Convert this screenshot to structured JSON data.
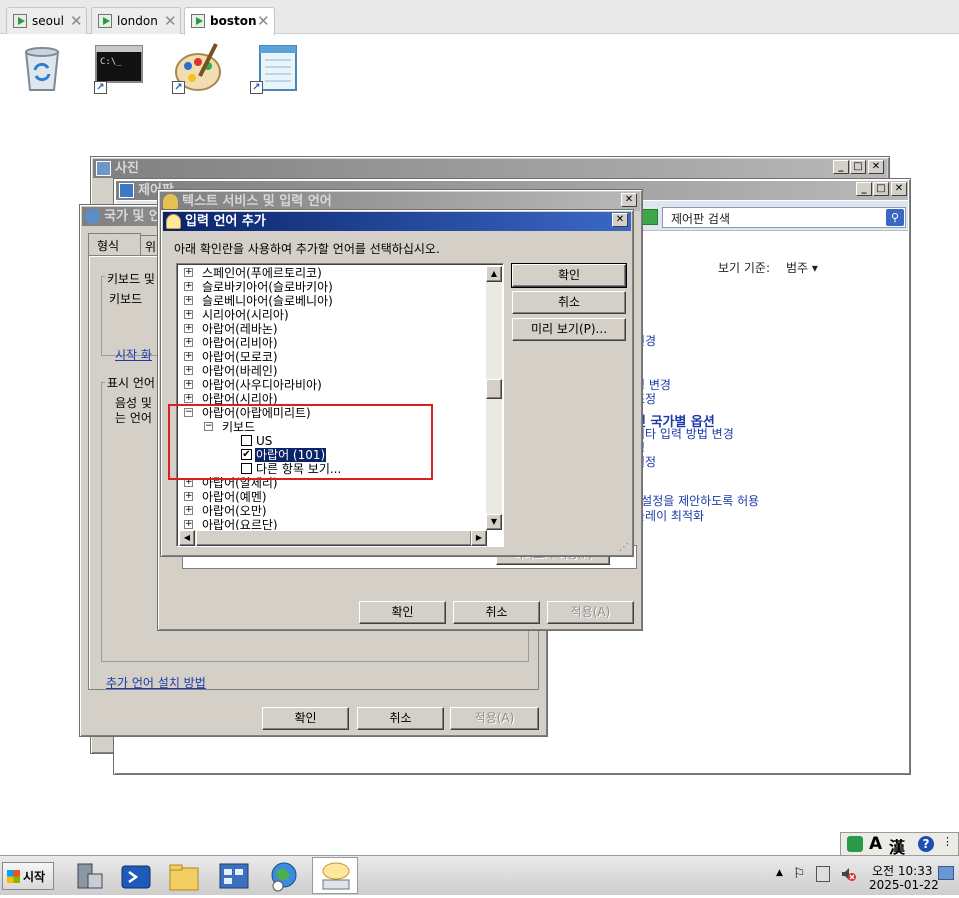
{
  "browser_tabs": [
    {
      "label": "seoul"
    },
    {
      "label": "london"
    },
    {
      "label": "boston"
    }
  ],
  "desktop": {
    "icons": [
      {
        "name": "recycle-bin"
      },
      {
        "name": "command-prompt"
      },
      {
        "name": "paint"
      },
      {
        "name": "notepad"
      }
    ]
  },
  "photos_window": {
    "title": "사진"
  },
  "control_panel": {
    "title": "제어판",
    "search_placeholder": "제어판 검색",
    "view_by_label": "보기 기준:",
    "view_by_value": "범주",
    "items": [
      {
        "text": "변경"
      },
      {
        "text": "경 변경"
      },
      {
        "text": "조정"
      },
      {
        "text": "및 국가별 옵션"
      },
      {
        "text": "기타 입력 방법 변경"
      },
      {
        "text": "경"
      },
      {
        "text": "설정"
      },
      {
        "text": "l 설정을 제안하도록 허용"
      },
      {
        "text": "들레이 최적화"
      }
    ]
  },
  "region_dialog": {
    "title": "국가 및 언어",
    "tabs": [
      "형식",
      "위"
    ],
    "keyboard_group": "키보드 및",
    "keyboard_text": "키보드 ",
    "start_link": "시작 화",
    "display_group": "표시 언어",
    "display_text_1": "음성 및",
    "display_text_2": "는 언어",
    "install_link": "추가 언어 설치 방법",
    "ok": "확인",
    "cancel": "취소",
    "apply": "적용(A)"
  },
  "text_services_dialog": {
    "title": "텍스트 서비스 및 입력 언어",
    "add_button_hint": "미리보기 허용(F)",
    "ok": "확인",
    "cancel": "취소",
    "apply": "적용(A)"
  },
  "add_language_dialog": {
    "title": "입력 언어 추가",
    "instruction": "아래 확인란을 사용하여 추가할 언어를 선택하십시오.",
    "ok": "확인",
    "cancel": "취소",
    "preview": "미리 보기(P)...",
    "tree": [
      {
        "label": "스페인어(푸에르토리코)",
        "level": 0,
        "expander": "+"
      },
      {
        "label": "슬로바키아어(슬로바키아)",
        "level": 0,
        "expander": "+"
      },
      {
        "label": "슬로베니아어(슬로베니아)",
        "level": 0,
        "expander": "+"
      },
      {
        "label": "시리아어(시리아)",
        "level": 0,
        "expander": "+"
      },
      {
        "label": "아랍어(레바논)",
        "level": 0,
        "expander": "+"
      },
      {
        "label": "아랍어(리비아)",
        "level": 0,
        "expander": "+"
      },
      {
        "label": "아랍어(모로코)",
        "level": 0,
        "expander": "+"
      },
      {
        "label": "아랍어(바레인)",
        "level": 0,
        "expander": "+"
      },
      {
        "label": "아랍어(사우디아라비아)",
        "level": 0,
        "expander": "+"
      },
      {
        "label": "아랍어(시리아)",
        "level": 0,
        "expander": "+"
      },
      {
        "label": "아랍어(아랍에미리트)",
        "level": 0,
        "expander": "-"
      },
      {
        "label": "키보드",
        "level": 1,
        "expander": "-"
      },
      {
        "label": "US",
        "level": 2,
        "checkbox": false
      },
      {
        "label": "아랍어 (101)",
        "level": 2,
        "checkbox": true,
        "selected": true
      },
      {
        "label": "다른 항목 보기...",
        "level": 2,
        "checkbox": false
      },
      {
        "label": "아랍어(알제리)",
        "level": 0,
        "expander": "+"
      },
      {
        "label": "아랍어(예멘)",
        "level": 0,
        "expander": "+"
      },
      {
        "label": "아랍어(오만)",
        "level": 0,
        "expander": "+"
      },
      {
        "label": "아랍어(요르단)",
        "level": 0,
        "expander": "+"
      }
    ]
  },
  "language_bar": {
    "lang_a": "A",
    "lang_han": "漢",
    "help": "?"
  },
  "taskbar": {
    "start_label": "시작",
    "clock_time": "오전 10:33",
    "clock_date": "2025-01-22"
  },
  "colors": {
    "highlight": "#0a246a",
    "annotation_red": "#d92020",
    "link": "#1a3ba8"
  }
}
